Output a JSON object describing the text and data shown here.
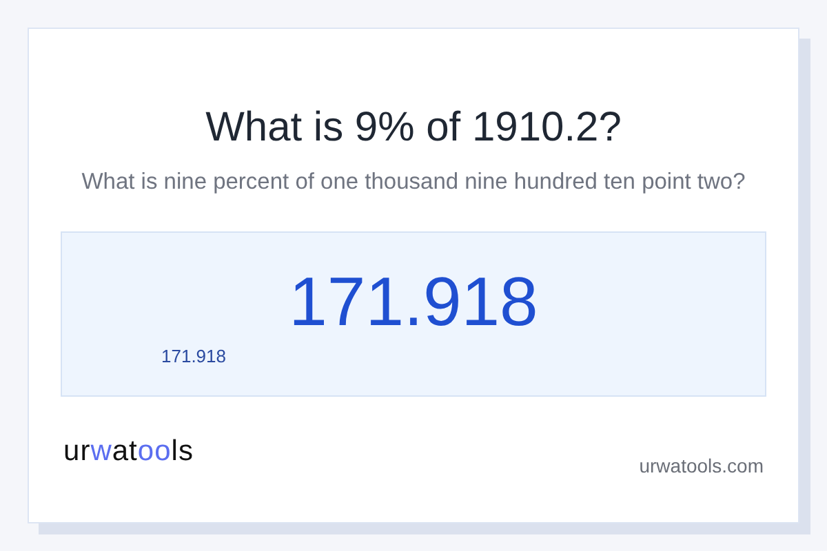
{
  "title": "What is 9% of 1910.2?",
  "subtitle": "What is nine percent of one thousand nine hundred ten point two?",
  "result": {
    "value": "171.918",
    "small_value": "171.918"
  },
  "footer": {
    "logo": "urwatools",
    "domain": "urwatools.com"
  }
}
